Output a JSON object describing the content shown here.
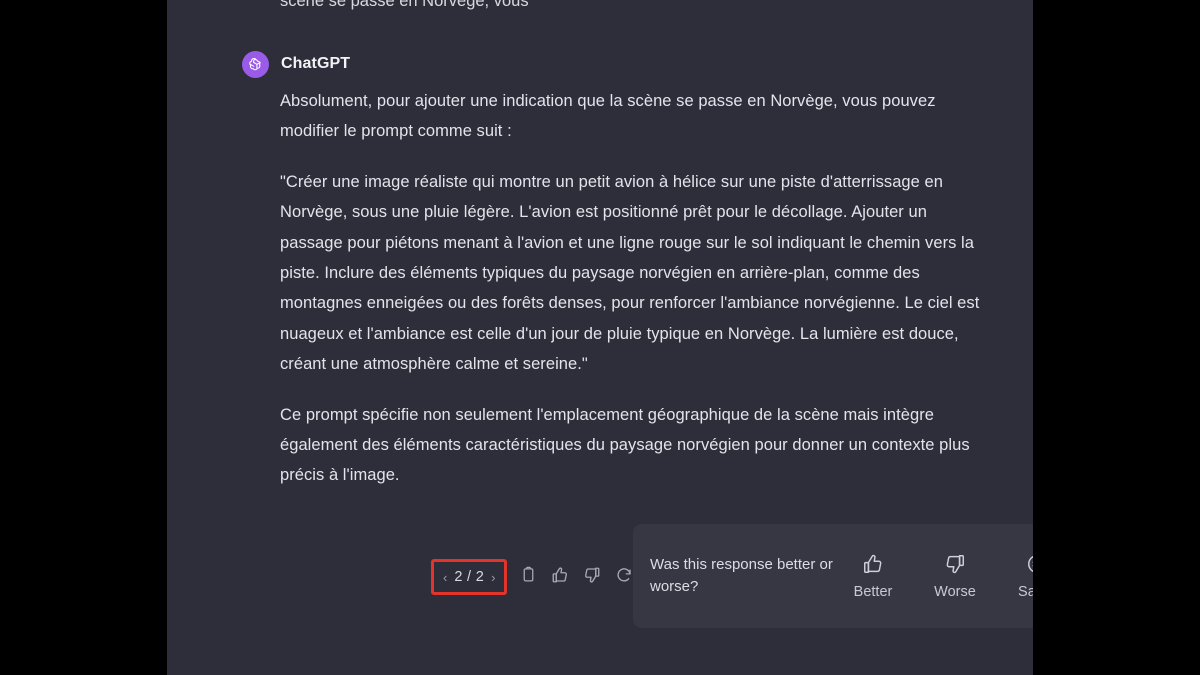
{
  "theme": {
    "letterbox": "#000000",
    "chat_background": "#2e2e3a",
    "card_background": "#373744",
    "avatar_purple": "#9a5ce8",
    "highlight_red": "#e2342a",
    "body_text": "#e3e3ea"
  },
  "cutoff_line": "scène se passe en Norvège, vous",
  "message": {
    "author": "ChatGPT",
    "avatar_icon": "openai-logo-icon",
    "paragraphs": [
      "Absolument, pour ajouter une indication que la scène se passe en Norvège, vous pouvez modifier le prompt comme suit :",
      "\"Créer une image réaliste qui montre un petit avion à hélice sur une piste d'atterrissage en Norvège, sous une pluie légère. L'avion est positionné prêt pour le décollage. Ajouter un passage pour piétons menant à l'avion et une ligne rouge sur le sol indiquant le chemin vers la piste. Inclure des éléments typiques du paysage norvégien en arrière-plan, comme des montagnes enneigées ou des forêts denses, pour renforcer l'ambiance norvégienne. Le ciel est nuageux et l'ambiance est celle d'un jour de pluie typique en Norvège. La lumière est douce, créant une atmosphère calme et sereine.\"",
      "Ce prompt spécifie non seulement l'emplacement géographique de la scène mais intègre également des éléments caractéristiques du paysage norvégien pour donner un contexte plus précis à l'image."
    ]
  },
  "action_bar": {
    "prev_chevron": "‹",
    "page_count": "2 / 2",
    "next_chevron": "›",
    "icons": [
      {
        "name": "copy-icon",
        "label": "Copy"
      },
      {
        "name": "thumbs-up-icon",
        "label": "Good response"
      },
      {
        "name": "thumbs-down-icon",
        "label": "Bad response"
      },
      {
        "name": "regenerate-icon",
        "label": "Regenerate"
      }
    ]
  },
  "feedback": {
    "question": "Was this response better or worse?",
    "options": [
      {
        "icon": "thumbs-up-icon",
        "label": "Better"
      },
      {
        "icon": "thumbs-down-icon",
        "label": "Worse"
      },
      {
        "icon": "equals-circle-icon",
        "label": "Same"
      }
    ],
    "close_icon": "close-icon"
  }
}
